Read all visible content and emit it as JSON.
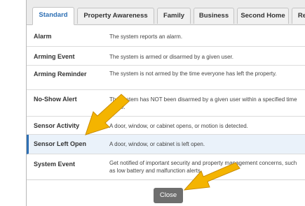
{
  "tabs": [
    {
      "label": "Standard"
    },
    {
      "label": "Property Awareness"
    },
    {
      "label": "Family"
    },
    {
      "label": "Business"
    },
    {
      "label": "Second Home"
    },
    {
      "label": "Re"
    }
  ],
  "rows": [
    {
      "name": "Alarm",
      "desc": "The system reports an alarm."
    },
    {
      "name": "Arming Event",
      "desc": "The system is armed or disarmed by a given user."
    },
    {
      "name": "Arming Reminder",
      "desc": "The system is not armed by the time everyone has left the property."
    },
    {
      "name": "No-Show Alert",
      "desc": "The system has NOT been disarmed by a given user within a specified time frame."
    },
    {
      "name": "Sensor Activity",
      "desc": "A door, window, or cabinet opens, or motion is detected."
    },
    {
      "name": "Sensor Left Open",
      "desc": "A door, window, or cabinet is left open."
    },
    {
      "name": "System Event",
      "desc": "Get notified of important security and property management concerns, such as low battery and malfunction alerts."
    }
  ],
  "footer": {
    "close_label": "Close"
  },
  "colors": {
    "accent": "#2d6fb4",
    "arrow": "#f4b400",
    "button": "#6e6e6e"
  }
}
